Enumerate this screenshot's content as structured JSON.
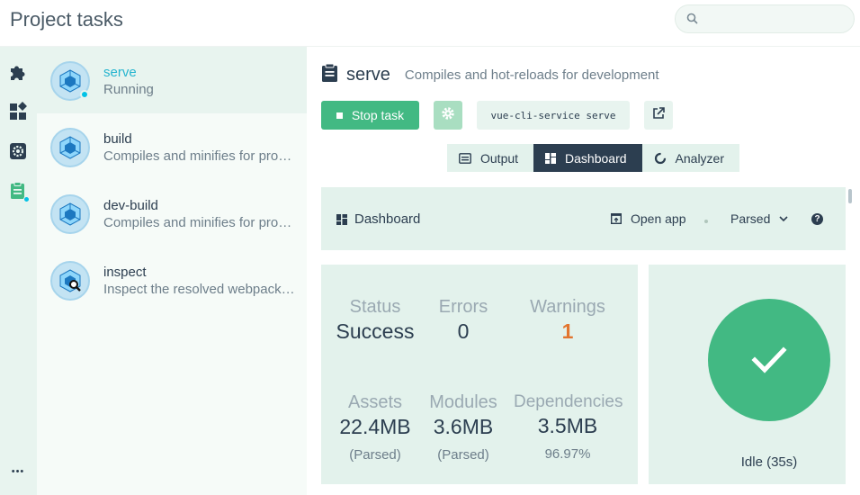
{
  "app": {
    "title": "Project tasks"
  },
  "search": {
    "placeholder": ""
  },
  "rail": {
    "items": [
      {
        "icon": "puzzle-icon"
      },
      {
        "icon": "dashboard-icon"
      },
      {
        "icon": "gear-icon"
      },
      {
        "icon": "clipboard-icon",
        "active": true
      }
    ],
    "more_label": "•••"
  },
  "tasks": [
    {
      "name": "serve",
      "description": "Running",
      "selected": true,
      "icon": "webpack-icon"
    },
    {
      "name": "build",
      "description": "Compiles and minifies for production",
      "icon": "webpack-icon"
    },
    {
      "name": "dev-build",
      "description": "Compiles and minifies for production",
      "icon": "webpack-icon"
    },
    {
      "name": "inspect",
      "description": "Inspect the resolved webpack config",
      "icon": "webpack-search-icon"
    }
  ],
  "main": {
    "task_name": "serve",
    "task_description": "Compiles and hot-reloads for development",
    "stop_label": "Stop task",
    "command": "vue-cli-service serve",
    "tabs": [
      {
        "label": "Output",
        "active": false
      },
      {
        "label": "Dashboard",
        "active": true
      },
      {
        "label": "Analyzer",
        "active": false
      }
    ]
  },
  "dashboard": {
    "title": "Dashboard",
    "open_app_label": "Open app",
    "mode_label": "Parsed",
    "help_label": "?",
    "stats": {
      "status_label": "Status",
      "status_value": "Success",
      "errors_label": "Errors",
      "errors_value": "0",
      "warnings_label": "Warnings",
      "warnings_value": "1",
      "assets_label": "Assets",
      "assets_value": "22.4MB",
      "assets_sub": "(Parsed)",
      "modules_label": "Modules",
      "modules_value": "3.6MB",
      "modules_sub": "(Parsed)",
      "deps_label": "Dependencies",
      "deps_value": "3.5MB",
      "deps_sub": "96.97%"
    },
    "state": "Idle (35s)"
  },
  "colors": {
    "accent": "#42b983",
    "dark": "#2c3e50",
    "panel": "#e3f2ec",
    "warning": "#e2752f",
    "running_dot": "#03c2e6"
  }
}
